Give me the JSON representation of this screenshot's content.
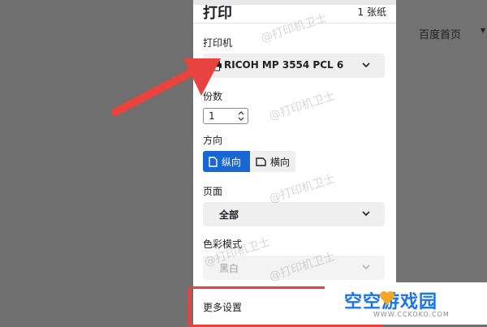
{
  "print_panel": {
    "title": "打印",
    "sheet_count": "1 张纸",
    "printer": {
      "label": "打印机",
      "value": "RICOH MP 3554 PCL 6",
      "icon": "printer-icon"
    },
    "copies": {
      "label": "份数",
      "value": "1"
    },
    "orientation": {
      "label": "方向",
      "portrait": "纵向",
      "landscape": "横向",
      "selected": "portrait"
    },
    "pages": {
      "label": "页面",
      "value": "全部"
    },
    "color_mode": {
      "label": "色彩模式",
      "value": "黑白"
    },
    "more_settings": "更多设置"
  },
  "background": {
    "home_link": "百度首页"
  },
  "watermark_text": "@打印机卫士",
  "logo": {
    "text": "空空游戏园",
    "sub": "WWW.CCKOKO.COM"
  },
  "colors": {
    "accent": "#1967d2",
    "highlight": "#e8433e",
    "logo_blue": "#1a73e8",
    "logo_orange": "#f5a623"
  }
}
